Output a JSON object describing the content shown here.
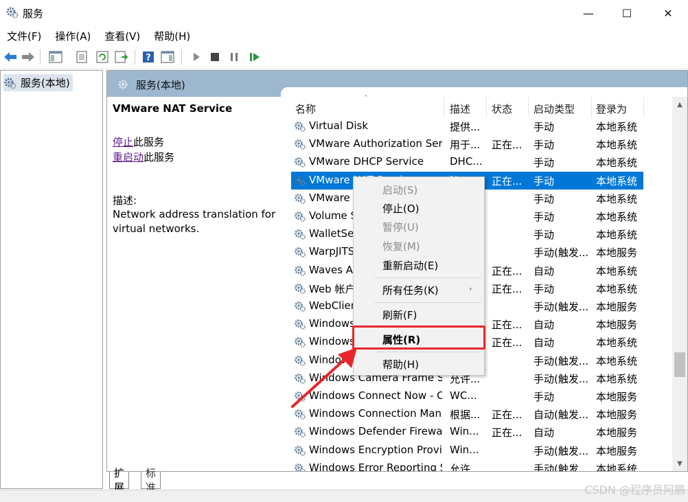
{
  "window": {
    "title": "服务",
    "minimize_glyph": "—",
    "maximize_glyph": "☐",
    "close_glyph": "✕"
  },
  "menubar": [
    {
      "label": "文件(F)"
    },
    {
      "label": "操作(A)"
    },
    {
      "label": "查看(V)"
    },
    {
      "label": "帮助(H)"
    }
  ],
  "toolbar": {
    "buttons": [
      "back-arrow-icon",
      "forward-arrow-icon",
      "show-hide-tree-icon",
      "properties-icon",
      "refresh-icon",
      "export-list-icon",
      "help-icon",
      "show-hide-action-pane-icon",
      "play-icon",
      "stop-icon",
      "pause-icon",
      "resume-icon"
    ]
  },
  "tree": {
    "item_label": "服务(本地)"
  },
  "pane": {
    "header": "服务(本地)",
    "selected_service": "VMware NAT Service",
    "stop_link": "停止",
    "stop_suffix": "此服务",
    "restart_link": "重启动",
    "restart_suffix": "此服务",
    "desc_label": "描述:",
    "desc_text": "Network address translation for virtual networks."
  },
  "columns": {
    "name": "名称",
    "desc": "描述",
    "status": "状态",
    "type": "启动类型",
    "logon": "登录为",
    "sort_glyph": "ˆ"
  },
  "rows": [
    {
      "name": "Virtual Disk",
      "desc": "提供...",
      "status": "",
      "type": "手动",
      "logon": "本地系统"
    },
    {
      "name": "VMware Authorization Ser...",
      "desc": "用于...",
      "status": "正在...",
      "type": "手动",
      "logon": "本地系统"
    },
    {
      "name": "VMware DHCP Service",
      "desc": "DHC...",
      "status": "",
      "type": "手动",
      "logon": "本地系统"
    },
    {
      "name": "VMware NAT Service",
      "desc": "N...",
      "status": "正在...",
      "type": "手动",
      "logon": "本地系统"
    },
    {
      "name": "VMware USB Arbitration...",
      "desc": "",
      "status": "",
      "type": "手动",
      "logon": "本地系统"
    },
    {
      "name": "Volume Shadow Copy",
      "desc": "",
      "status": "",
      "type": "手动",
      "logon": "本地系统"
    },
    {
      "name": "WalletService",
      "desc": "",
      "status": "",
      "type": "手动",
      "logon": "本地系统"
    },
    {
      "name": "WarpJITSvc",
      "desc": "",
      "status": "",
      "type": "手动(触发...",
      "logon": "本地服务"
    },
    {
      "name": "Waves Audio Services",
      "desc": "",
      "status": "正在...",
      "type": "自动",
      "logon": "本地系统"
    },
    {
      "name": "Web 帐户管理器",
      "desc": "",
      "status": "正在...",
      "type": "手动",
      "logon": "本地系统"
    },
    {
      "name": "WebClient",
      "desc": "",
      "status": "",
      "type": "手动(触发...",
      "logon": "本地服务"
    },
    {
      "name": "Windows Audio",
      "desc": "",
      "status": "正在...",
      "type": "自动",
      "logon": "本地服务"
    },
    {
      "name": "Windows Audio Endpoint...",
      "desc": "",
      "status": "正在...",
      "type": "自动",
      "logon": "本地系统"
    },
    {
      "name": "Windows Biometric Service",
      "desc": "",
      "status": "",
      "type": "手动(触发...",
      "logon": "本地系统"
    },
    {
      "name": "Windows Camera Frame S...",
      "desc": "允许...",
      "status": "",
      "type": "手动(触发...",
      "logon": "本地系统"
    },
    {
      "name": "Windows Connect Now - C...",
      "desc": "WC...",
      "status": "",
      "type": "手动",
      "logon": "本地服务"
    },
    {
      "name": "Windows Connection Man...",
      "desc": "根据...",
      "status": "正在...",
      "type": "自动(触发...",
      "logon": "本地服务"
    },
    {
      "name": "Windows Defender Firewall",
      "desc": "Win...",
      "status": "正在...",
      "type": "自动",
      "logon": "本地服务"
    },
    {
      "name": "Windows Encryption Provid...",
      "desc": "Win...",
      "status": "",
      "type": "手动(触发...",
      "logon": "本地服务"
    },
    {
      "name": "Windows Error Reporting S...",
      "desc": "允许...",
      "status": "",
      "type": "手动(触发...",
      "logon": "本地系统"
    }
  ],
  "context_menu": {
    "start": "启动(S)",
    "stop": "停止(O)",
    "pause": "暂停(U)",
    "resume": "恢复(M)",
    "restart": "重新启动(E)",
    "all_tasks": "所有任务(K)",
    "all_tasks_arrow": "›",
    "refresh": "刷新(F)",
    "properties": "属性(R)",
    "help": "帮助(H)"
  },
  "tabs": {
    "extended": "扩展",
    "standard": "标准"
  },
  "watermark": "CSDN @程序员阿鹏",
  "colors": {
    "selection": "#0078d7",
    "header_band": "#9db7cf",
    "highlight_box": "#e8262a",
    "link": "#5c1b8d"
  }
}
